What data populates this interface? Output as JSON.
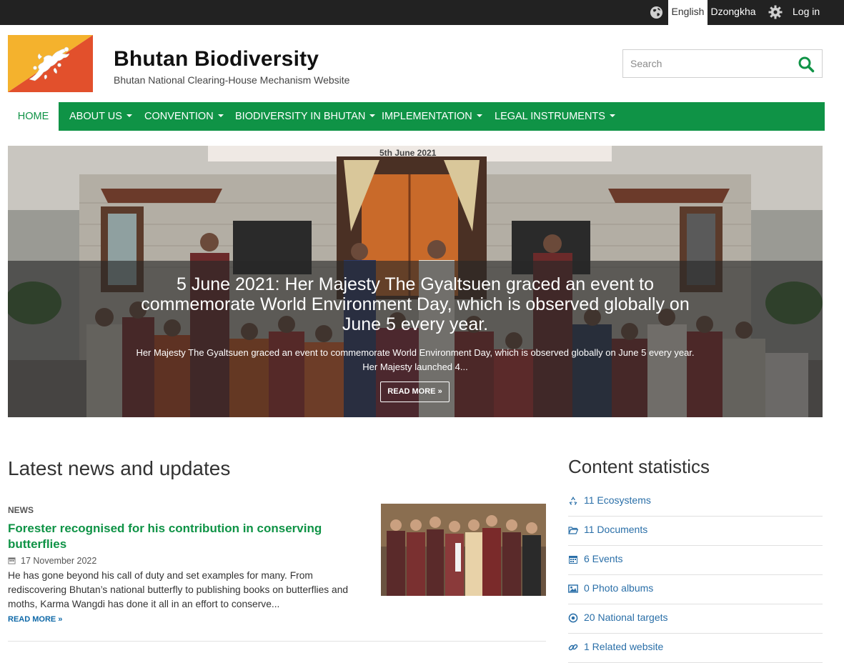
{
  "topbar": {
    "lang_english": "English",
    "lang_dzongkha": "Dzongkha",
    "login": "Log in"
  },
  "header": {
    "site_title": "Bhutan Biodiversity",
    "site_slogan": "Bhutan National Clearing-House Mechanism Website",
    "search_placeholder": "Search"
  },
  "nav": {
    "items": [
      {
        "label": "HOME",
        "active": true
      },
      {
        "label": "ABOUT US",
        "dropdown": true
      },
      {
        "label": "CONVENTION",
        "dropdown": true
      },
      {
        "label": "BIODIVERSITY IN BHUTAN",
        "dropdown": true
      },
      {
        "label": "IMPLEMENTATION",
        "dropdown": true
      },
      {
        "label": "LEGAL INSTRUMENTS",
        "dropdown": true
      }
    ]
  },
  "hero": {
    "banner_text": "5th June 2021",
    "title": "5 June 2021: Her Majesty The Gyaltsuen graced an event to commemorate World Environment Day, which is observed globally on June 5 every year.",
    "summary": "Her Majesty The Gyaltsuen graced an event to commemorate World Environment Day, which is observed globally on June 5 every year. Her Majesty launched 4...",
    "button": "READ MORE »"
  },
  "news": {
    "heading": "Latest news and updates",
    "item": {
      "type": "NEWS",
      "title": "Forester recognised for his contribution in conserving butterflies",
      "date": "17 November 2022",
      "summary": "He has gone beyond his call of duty and set examples for many. From rediscovering Bhutan’s national butterfly to publishing books on butterflies and moths, Karma Wangdi has done it all in an effort to conserve...",
      "more": "READ MORE »"
    }
  },
  "stats": {
    "heading": "Content statistics",
    "items": [
      {
        "icon": "recycle-icon",
        "label": "11 Ecosystems"
      },
      {
        "icon": "folder-open-icon",
        "label": "11 Documents"
      },
      {
        "icon": "calendar-icon",
        "label": "6 Events"
      },
      {
        "icon": "image-icon",
        "label": "0 Photo albums"
      },
      {
        "icon": "target-icon",
        "label": "20 National targets"
      },
      {
        "icon": "link-icon",
        "label": "1 Related website"
      }
    ]
  },
  "colors": {
    "brand_green": "#0f9346",
    "link_blue": "#2a6fa8",
    "topbar": "#222222"
  }
}
